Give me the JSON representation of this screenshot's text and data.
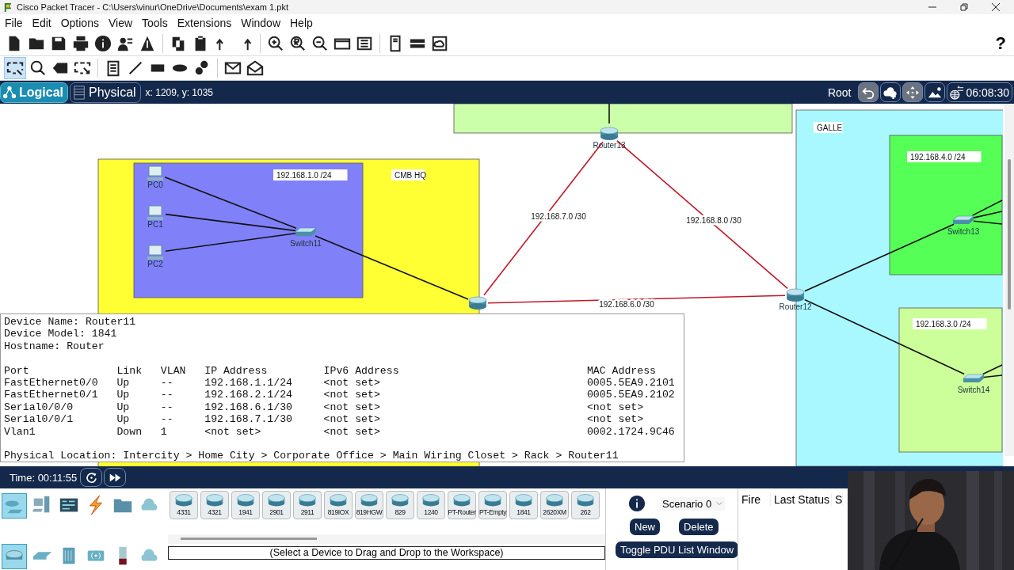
{
  "window": {
    "title": "Cisco Packet Tracer - C:\\Users\\vinur\\OneDrive\\Documents\\exam 1.pkt"
  },
  "menu": [
    "File",
    "Edit",
    "Options",
    "View",
    "Tools",
    "Extensions",
    "Window",
    "Help"
  ],
  "help": "?",
  "edit_tools": [
    {
      "selected": true
    },
    {
      "selected": false
    },
    {
      "selected": false
    },
    {
      "selected": false
    },
    {
      "selected": false
    },
    {
      "selected": false
    },
    {
      "selected": false
    },
    {
      "selected": false
    },
    {
      "selected": false
    },
    {
      "selected": false
    },
    {
      "selected": false
    }
  ],
  "view_tabs": [
    {
      "label": "Logical",
      "selected": true
    },
    {
      "label": "Physical",
      "selected": false
    }
  ],
  "coordinates": "x: 1209, y: 1035",
  "root": "Root",
  "clock": "06:08:30",
  "workspace": {
    "areas": [
      {
        "color": "#ccffaa"
      },
      {
        "label": "CMB HQ",
        "color": "#ffff33"
      },
      {
        "label": "192.168.1.0 /24",
        "color": "#8080f8"
      },
      {
        "label": "GALLE",
        "color": "#aaf8ff"
      },
      {
        "label": "192.168.4.0 /24",
        "color": "#55ff55"
      },
      {
        "label": "192.168.3.0 /24",
        "color": "#ccff99"
      }
    ],
    "devices": [
      {
        "kind": "pc",
        "name": "PC0"
      },
      {
        "kind": "pc",
        "name": "PC1"
      },
      {
        "kind": "pc",
        "name": "PC2"
      },
      {
        "kind": "switch",
        "name": "Switch11"
      },
      {
        "kind": "router"
      },
      {
        "kind": "router",
        "name": "Router13"
      },
      {
        "kind": "router",
        "name": "Router12"
      },
      {
        "kind": "switch",
        "name": "Switch13"
      },
      {
        "kind": "switch",
        "name": "Switch14"
      }
    ],
    "link_labels": [
      "192.168.7.0 /30",
      "192.168.8.0 /30",
      "192.168.6.0 /30"
    ]
  },
  "device_info": {
    "header": [
      "Device Name: Router11",
      "Device Model: 1841",
      "Hostname: Router"
    ],
    "columns": [
      "Port",
      "Link",
      "VLAN",
      "IP Address",
      "IPv6 Address",
      "MAC Address"
    ],
    "rows": [
      [
        "FastEthernet0/0",
        "Up",
        "--",
        "192.168.1.1/24",
        "<not set>",
        "0005.5EA9.2101"
      ],
      [
        "FastEthernet0/1",
        "Up",
        "--",
        "192.168.2.1/24",
        "<not set>",
        "0005.5EA9.2102"
      ],
      [
        "Serial0/0/0",
        "Up",
        "--",
        "192.168.6.1/30",
        "<not set>",
        "<not set>"
      ],
      [
        "Serial0/0/1",
        "Up",
        "--",
        "192.168.7.1/30",
        "<not set>",
        "<not set>"
      ],
      [
        "Vlan1",
        "Down",
        "1",
        "<not set>",
        "<not set>",
        "0002.1724.9C46"
      ]
    ],
    "location": "Physical Location: Intercity > Home City > Corporate Office > Main Wiring Closet > Rack > Router11"
  },
  "time": "Time: 00:11:55",
  "device_categories": [
    {
      "selected": true
    },
    {
      "selected": false
    },
    {
      "selected": false
    },
    {
      "selected": false
    },
    {
      "selected": false
    },
    {
      "selected": false
    }
  ],
  "device_types": [
    {
      "selected": true
    },
    {
      "selected": false
    },
    {
      "selected": false
    },
    {
      "selected": false
    },
    {
      "selected": false
    },
    {
      "selected": false
    }
  ],
  "device_models": [
    "4331",
    "4321",
    "1941",
    "2901",
    "2911",
    "819IOX",
    "819HGW",
    "829",
    "1240",
    "PT-Router",
    "PT-Empty",
    "1841",
    "2620XM",
    "262"
  ],
  "device_hint": "(Select a Device to Drag and Drop to the Workspace)",
  "pdu": {
    "scenario": "Scenario 0",
    "buttons": [
      "New",
      "Delete"
    ],
    "toggle": "Toggle PDU List Window",
    "columns": [
      "Fire",
      "Last Status",
      "S"
    ]
  },
  "webcam": {
    "kind": "picture"
  }
}
